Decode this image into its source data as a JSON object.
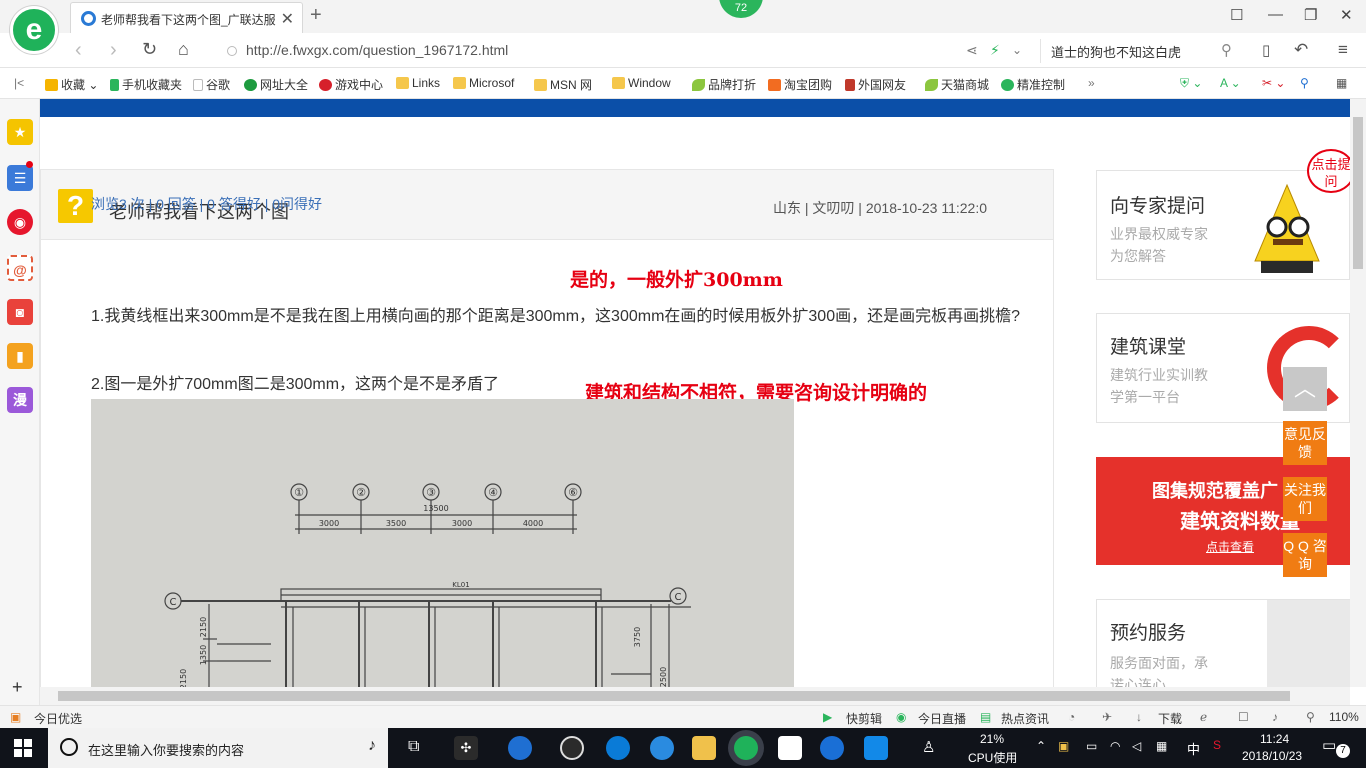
{
  "browser": {
    "tab_title": "老师帮我看下这两个图_广联达服",
    "badge_count": "72",
    "url": "http://e.fwxgx.com/question_1967172.html",
    "search_text": "道士的狗也不知这白虎",
    "favorites": [
      {
        "label": "收藏",
        "icon": "star-icon",
        "color": "#f5b400"
      },
      {
        "label": "手机收藏夹",
        "icon": "phone-icon",
        "color": "#2bb55c"
      },
      {
        "label": "谷歌",
        "icon": "page-icon",
        "color": "#dddddd"
      },
      {
        "label": "网址大全",
        "icon": "globe-icon",
        "color": "#1e9b3f"
      },
      {
        "label": "游戏中心",
        "icon": "game-icon",
        "color": "#d6202b"
      },
      {
        "label": "Links",
        "icon": "folder-icon",
        "color": "#f5c74c"
      },
      {
        "label": "Microsof",
        "icon": "folder-icon",
        "color": "#f5c74c"
      },
      {
        "label": "MSN 网",
        "icon": "folder-icon",
        "color": "#f5c74c"
      },
      {
        "label": "Window",
        "icon": "folder-icon",
        "color": "#f5c74c"
      },
      {
        "label": "品牌打折",
        "icon": "leaf-icon",
        "color": "#8cc63f"
      },
      {
        "label": "淘宝团购",
        "icon": "taobao-icon",
        "color": "#f26c21"
      },
      {
        "label": "外国网友",
        "icon": "bookmark-icon",
        "color": "#c0392b"
      },
      {
        "label": "天猫商城",
        "icon": "leaf-icon",
        "color": "#8cc63f"
      },
      {
        "label": "精准控制",
        "icon": "wechat-icon",
        "color": "#2bb55c"
      }
    ]
  },
  "question": {
    "title": "老师帮我看下这两个图",
    "meta": "山东 | 文叨叨 | 2018-10-23 11:22:0",
    "stats": "浏览3 次 | 0 回答 | 0 答得好 | 0问得好",
    "para1": "1.我黄线框出来300mm是不是我在图上用横向画的那个距离是300mm，这300mm在画的时候用板外扩300画，还是画完板再画挑檐?",
    "para2": "2.图一是外扩700mm图二是300mm，这两个是不是矛盾了",
    "annotation1": "是的，一般外扩300mm",
    "annotation2": "建筑和结构不相符，需要咨询设计明确的",
    "drawing": {
      "axis_labels": [
        "①",
        "②",
        "③",
        "④",
        "⑥"
      ],
      "total_dim": "13500",
      "dims": [
        "3000",
        "3500",
        "3000",
        "4000"
      ],
      "row_label": "C",
      "top_mark": "KL01",
      "side_dims": [
        "2150",
        "1350",
        "2150",
        "3750",
        "2500"
      ]
    }
  },
  "sidebar": {
    "expert": {
      "title": "向专家提问",
      "line1": "业界最权威专家",
      "line2": "为您解答",
      "bubble": "点击提问"
    },
    "course": {
      "title": "建筑课堂",
      "line1": "建筑行业实训教",
      "line2": "学第一平台"
    },
    "banner": {
      "line1": "图集规范覆盖广",
      "line2": "建筑资料数量",
      "cta": "点击查看"
    },
    "service": {
      "title": "预约服务",
      "line1": "服务面对面，承",
      "line2": "诺心连心"
    },
    "float": {
      "feedback": "意见反馈",
      "follow": "关注我们",
      "qq": "Q Q 咨询"
    }
  },
  "statusbar": {
    "left": "今日优选",
    "items": [
      "快剪辑",
      "今日直播",
      "热点资讯",
      "下载"
    ],
    "zoom": "110%"
  },
  "taskbar": {
    "search_placeholder": "在这里输入你要搜索的内容",
    "cpu_percent": "21%",
    "cpu_label": "CPU使用",
    "ime": "中",
    "time": "11:24",
    "date": "2018/10/23",
    "notifications": "7"
  }
}
